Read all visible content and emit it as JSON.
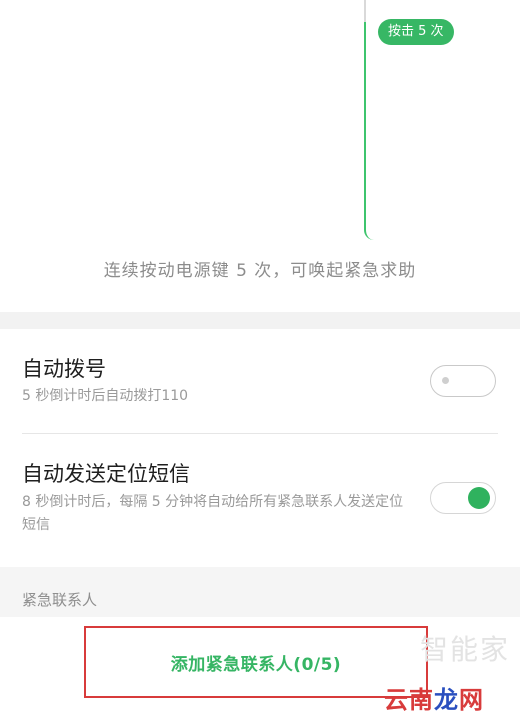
{
  "illustration": {
    "press_badge": "按击 5 次",
    "caption": "连续按动电源键 5 次，可唤起紧急求助"
  },
  "settings": {
    "auto_dial": {
      "title": "自动拨号",
      "description": "5 秒倒计时后自动拨打110",
      "enabled": false
    },
    "auto_sms": {
      "title": "自动发送定位短信",
      "description": "8 秒倒计时后，每隔 5 分钟将自动给所有紧急联系人发送定位短信",
      "enabled": true
    }
  },
  "emergency_contacts": {
    "section_title": "紧急联系人",
    "add_button_label": "添加紧急联系人(0/5)"
  },
  "watermarks": {
    "faint": "智能家",
    "brand_part1": "云南",
    "brand_part2": "龙",
    "brand_part3": "网"
  },
  "colors": {
    "accent_green": "#37b765",
    "highlight_red": "#d83b3b"
  }
}
